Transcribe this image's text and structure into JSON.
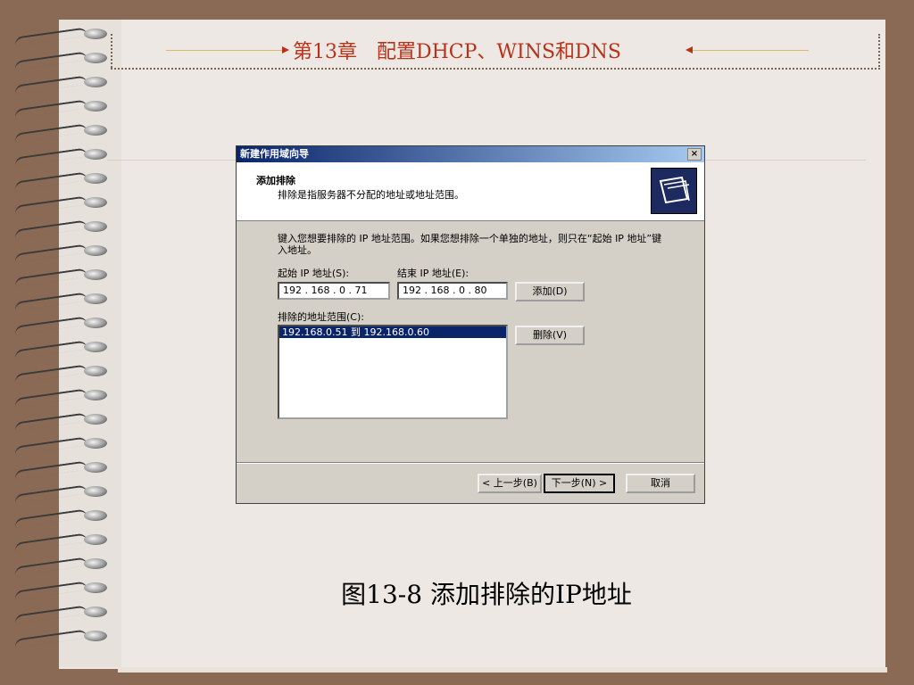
{
  "slide": {
    "header_title": "第13章　配置DHCP、WINS和DNS",
    "caption": "图13-8  添加排除的IP地址"
  },
  "dialog": {
    "title": "新建作用域向导",
    "close_label": "×",
    "top_title": "添加排除",
    "top_subtitle": "排除是指服务器不分配的地址或地址范围。",
    "instruction": "键入您想要排除的 IP 地址范围。如果您想排除一个单独的地址，则只在“起始 IP 地址”键入地址。",
    "start_ip_label": "起始 IP 地址(S):",
    "end_ip_label": "结束 IP 地址(E):",
    "start_ip_value": "192 . 168 .  0  . 71",
    "end_ip_value": "192 . 168 .  0  . 80",
    "add_button": "添加(D)",
    "excluded_label": "排除的地址范围(C):",
    "excluded_ranges": [
      "192.168.0.51 到 192.168.0.60"
    ],
    "remove_button": "删除(V)",
    "back_button": "< 上一步(B)",
    "next_button": "下一步(N) >",
    "cancel_button": "取消"
  },
  "colors": {
    "background": "#8a6a55",
    "page": "#ede8e3",
    "header_text": "#b8321a",
    "titlebar": "#0a246a"
  }
}
